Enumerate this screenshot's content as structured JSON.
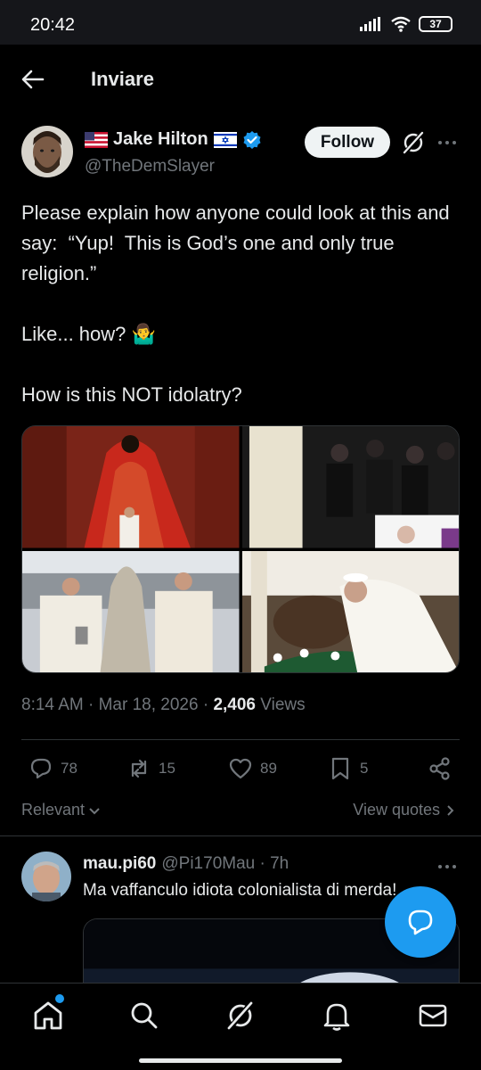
{
  "status_bar": {
    "time": "20:42",
    "battery": "37"
  },
  "header": {
    "title": "Inviare"
  },
  "author": {
    "name": "Jake Hilton",
    "handle": "@TheDemSlayer",
    "follow_label": "Follow"
  },
  "tweet": {
    "text": "Please explain how anyone could look at this and say:  “Yup!  This is God’s one and only true religion.”\n\nLike... how? 🤷‍♂️\n\nHow is this NOT idolatry?",
    "time": "8:14 AM · Mar 18, 2026 ·",
    "views_count": "2,406",
    "views_label": "Views"
  },
  "actions": {
    "replies": "78",
    "reposts": "15",
    "likes": "89",
    "bookmarks": "5"
  },
  "sort": {
    "relevant_label": "Relevant",
    "view_quotes_label": "View quotes"
  },
  "reply": {
    "name": "mau.pi60",
    "handle": "@Pi170Mau · 7h",
    "text": "Ma vaffanculo idiota colonialista di merda!"
  },
  "colors": {
    "accent": "#1d9bf0",
    "text": "#e7e9ea",
    "muted": "#71767b",
    "border": "#2f3336"
  }
}
